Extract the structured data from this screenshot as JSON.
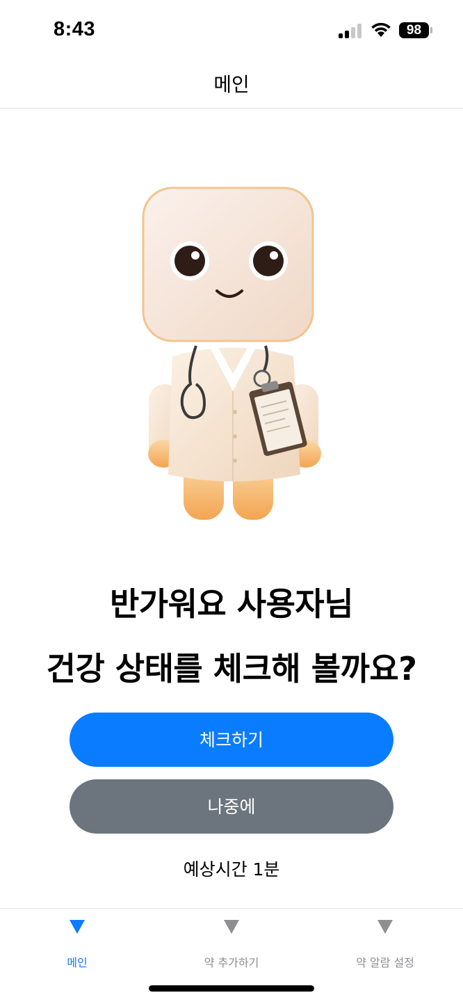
{
  "status_bar": {
    "time": "8:43",
    "battery": "98"
  },
  "nav": {
    "title": "메인"
  },
  "mascot": {
    "description_icon": "doctor-mascot-icon"
  },
  "greeting": {
    "line1": "반가워요 사용자님",
    "line2": "건강 상태를 체크해 볼까요?"
  },
  "actions": {
    "primary_label": "체크하기",
    "secondary_label": "나중에"
  },
  "estimate": "예상시간 1분",
  "tabbar": {
    "items": [
      {
        "label": "메인",
        "active": true
      },
      {
        "label": "약 추가하기",
        "active": false
      },
      {
        "label": "약 알람 설정",
        "active": false
      }
    ]
  },
  "colors": {
    "accent": "#0a7cff",
    "secondary": "#6c757d",
    "inactive_tab": "#8e8e93"
  }
}
